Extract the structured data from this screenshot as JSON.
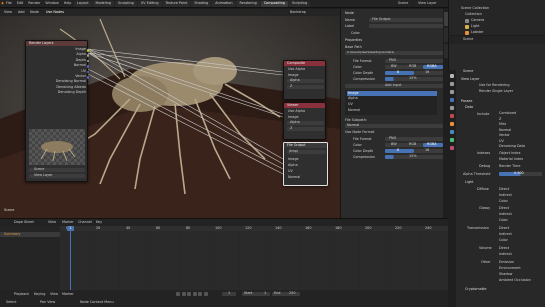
{
  "app": {
    "menus": [
      "File",
      "Edit",
      "Render",
      "Window",
      "Help"
    ],
    "workspace_tabs": [
      "Layout",
      "Modeling",
      "Sculpting",
      "UV Editing",
      "Texture Paint",
      "Shading",
      "Animation",
      "Rendering",
      "Compositing",
      "Scripting"
    ],
    "active_tab": "Compositing",
    "scene_name": "Scene",
    "view_layer": "View Layer"
  },
  "node_editor": {
    "header_items": [
      "View",
      "Add",
      "Node"
    ],
    "use_nodes_label": "Use Nodes",
    "backdrop_label": "Backdrop",
    "render_layers_node": {
      "title": "Render Layers",
      "outputs": [
        "Image",
        "Alpha",
        "Depth",
        "Normal",
        "UV",
        "Vector",
        "Denoising Normal",
        "Denoising Albedo",
        "Denoising Depth"
      ],
      "scene_value": "Scene",
      "layer_value": "View Layer"
    },
    "composite_node": {
      "title": "Composite",
      "use_alpha": "Use Alpha",
      "inputs": [
        "Image",
        "Alpha",
        "Z"
      ]
    },
    "viewer_node": {
      "title": "Viewer",
      "use_alpha": "Use Alpha",
      "inputs": [
        "Image",
        "Alpha",
        "Z"
      ]
    },
    "file_output_node": {
      "title": "File Output",
      "base_path": "/tmp/",
      "inputs": [
        "Image",
        "Alpha",
        "UV",
        "Normal"
      ]
    },
    "footer_label": "Scene"
  },
  "node_sidebar": {
    "node_section": "Node",
    "name_label": "Name",
    "name_value": "File Output",
    "label_label": "Label",
    "color_label": "Color",
    "properties_section": "Properties",
    "base_path_label": "Base Path",
    "base_path_value": "C:\\Users\\User\\Desktop\\renders\\",
    "file_format_label": "File Format",
    "file_format_value": "PNG",
    "color_label2": "Color",
    "color_modes": [
      "BW",
      "RGB",
      "RGBA"
    ],
    "color_depth_label": "Color Depth",
    "color_depths": [
      "8",
      "16"
    ],
    "compression_label": "Compression",
    "compression_value": "15%",
    "add_input_label": "Add Input",
    "inputs_list": [
      "Image",
      "Alpha",
      "UV",
      "Normal"
    ],
    "file_subpath_label": "File Subpath:",
    "file_subpath_value": "Normal",
    "use_node_format_label": "Use Node Format",
    "format_value2": "PNG"
  },
  "outliner": {
    "title": "Scene Collection",
    "items": [
      "Collection",
      "Camera",
      "Light",
      "Lobster"
    ]
  },
  "properties_editor": {
    "scene_label": "Scene",
    "scene_value": "Scene",
    "view_layer_section": "View Layer",
    "use_for_rendering": "Use for Rendering",
    "render_single_layer": "Render Single Layer",
    "passes_section": "Passes",
    "data_section": "Data",
    "include_label": "Include",
    "data_passes": [
      "Combined",
      "Z",
      "Mist",
      "Normal",
      "Vector",
      "UV"
    ],
    "denoising_label": "Denoising Data",
    "indexes_label": "Indexes",
    "index_items": [
      "Object Index",
      "Material Index"
    ],
    "debug_label": "Debug",
    "debug_item": "Render Time",
    "alpha_threshold_label": "Alpha Threshold",
    "alpha_threshold_value": "0.500",
    "light_section": "Light",
    "light_rows": [
      {
        "name": "Diffuse",
        "items": [
          "Direct",
          "Indirect",
          "Color"
        ]
      },
      {
        "name": "Glossy",
        "items": [
          "Direct",
          "Indirect",
          "Color"
        ]
      },
      {
        "name": "Transmission",
        "items": [
          "Direct",
          "Indirect",
          "Color"
        ]
      },
      {
        "name": "Volume",
        "items": [
          "Direct",
          "Indirect"
        ]
      },
      {
        "name": "Other",
        "items": [
          "Emission",
          "Environment",
          "Shadow",
          "Ambient Occlusion"
        ]
      }
    ],
    "cryptomatte_section": "Cryptomatte"
  },
  "timeline": {
    "header_items": [
      "View",
      "Marker",
      "Channel",
      "Key"
    ],
    "mode_label": "Dope Sheet",
    "summary_label": "Summary",
    "ruler": [
      "0",
      "20",
      "40",
      "60",
      "80",
      "100",
      "120",
      "140",
      "160",
      "180",
      "200",
      "220",
      "240"
    ],
    "current_frame": "1",
    "start_label": "Start",
    "start_value": "1",
    "end_label": "End",
    "end_value": "250",
    "playback_label": "Playback",
    "keying_label": "Keying",
    "view_label": "View",
    "marker_label": "Marker"
  },
  "status": {
    "left": "Select",
    "middle": "Pan View",
    "right": "Node Context Menu"
  }
}
